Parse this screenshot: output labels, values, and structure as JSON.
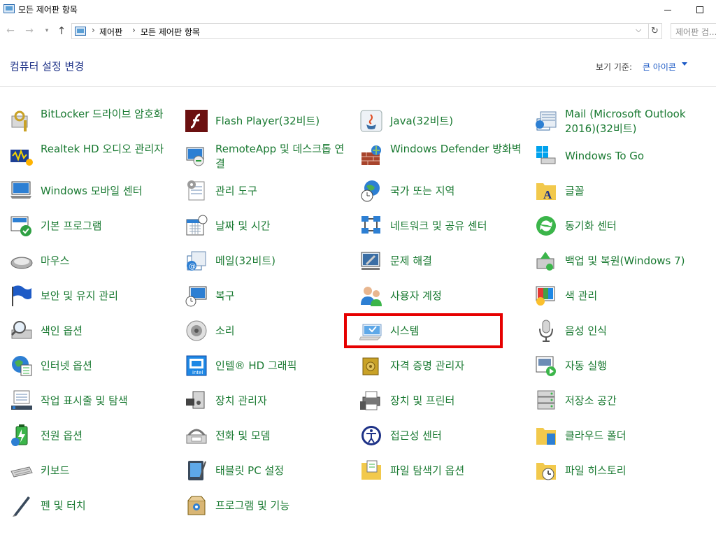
{
  "window": {
    "title": "모든 제어판 항목"
  },
  "address": {
    "crumbs": [
      "제어판",
      "모든 제어판 항목"
    ],
    "search_placeholder": "제어판 검..."
  },
  "header": {
    "title": "컴퓨터 설정 변경",
    "view_by_label": "보기 기준:",
    "view_by_value": "큰 아이콘"
  },
  "items": [
    {
      "label": "BitLocker 드라이브 암호화",
      "icon": "bitlocker-key-icon"
    },
    {
      "label": "Flash Player(32비트)",
      "icon": "flash-icon"
    },
    {
      "label": "Java(32비트)",
      "icon": "java-icon"
    },
    {
      "label": "Mail (Microsoft Outlook 2016)(32비트)",
      "icon": "mail-icon"
    },
    {
      "label": "Realtek HD 오디오 관리자",
      "icon": "audio-icon"
    },
    {
      "label": "RemoteApp 및 데스크톱 연결",
      "icon": "remote-desktop-icon"
    },
    {
      "label": "Windows Defender 방화벽",
      "icon": "firewall-icon"
    },
    {
      "label": "Windows To Go",
      "icon": "usb-drive-icon"
    },
    {
      "label": "Windows 모바일 센터",
      "icon": "mobility-center-icon"
    },
    {
      "label": "관리 도구",
      "icon": "admin-tools-icon"
    },
    {
      "label": "국가 또는 지역",
      "icon": "globe-clock-icon"
    },
    {
      "label": "글꼴",
      "icon": "font-folder-icon"
    },
    {
      "label": "기본 프로그램",
      "icon": "default-programs-icon"
    },
    {
      "label": "날짜 및 시간",
      "icon": "calendar-icon"
    },
    {
      "label": "네트워크 및 공유 센터",
      "icon": "network-icon"
    },
    {
      "label": "동기화 센터",
      "icon": "sync-icon"
    },
    {
      "label": "마우스",
      "icon": "mouse-icon"
    },
    {
      "label": "메일(32비트)",
      "icon": "mail-32-icon"
    },
    {
      "label": "문제 해결",
      "icon": "troubleshoot-icon"
    },
    {
      "label": "백업 및 복원(Windows 7)",
      "icon": "backup-icon"
    },
    {
      "label": "보안 및 유지 관리",
      "icon": "security-flag-icon"
    },
    {
      "label": "복구",
      "icon": "recovery-icon"
    },
    {
      "label": "사용자 계정",
      "icon": "user-accounts-icon"
    },
    {
      "label": "색 관리",
      "icon": "color-management-icon"
    },
    {
      "label": "색인 옵션",
      "icon": "indexing-icon"
    },
    {
      "label": "소리",
      "icon": "speaker-icon"
    },
    {
      "label": "시스템",
      "icon": "system-icon"
    },
    {
      "label": "음성 인식",
      "icon": "microphone-icon"
    },
    {
      "label": "인터넷 옵션",
      "icon": "internet-options-icon"
    },
    {
      "label": "인텔® HD 그래픽",
      "icon": "intel-graphics-icon"
    },
    {
      "label": "자격 증명 관리자",
      "icon": "credential-vault-icon"
    },
    {
      "label": "자동 실행",
      "icon": "autoplay-icon"
    },
    {
      "label": "작업 표시줄 및 탐색",
      "icon": "taskbar-icon"
    },
    {
      "label": "장치 관리자",
      "icon": "device-manager-icon"
    },
    {
      "label": "장치 및 프린터",
      "icon": "printer-icon"
    },
    {
      "label": "저장소 공간",
      "icon": "storage-icon"
    },
    {
      "label": "전원 옵션",
      "icon": "power-icon"
    },
    {
      "label": "전화 및 모뎀",
      "icon": "phone-modem-icon"
    },
    {
      "label": "접근성 센터",
      "icon": "accessibility-icon"
    },
    {
      "label": "클라우드 폴더",
      "icon": "cloud-folder-icon"
    },
    {
      "label": "키보드",
      "icon": "keyboard-icon"
    },
    {
      "label": "태블릿 PC 설정",
      "icon": "tablet-icon"
    },
    {
      "label": "파일 탐색기 옵션",
      "icon": "explorer-options-icon"
    },
    {
      "label": "파일 히스토리",
      "icon": "file-history-icon"
    },
    {
      "label": "펜 및 터치",
      "icon": "pen-icon"
    },
    {
      "label": "프로그램 및 기능",
      "icon": "programs-icon"
    }
  ],
  "highlight_item": "시스템",
  "colors": {
    "link": "#1a7a32",
    "title": "#1e3287",
    "highlight": "#e60000"
  }
}
